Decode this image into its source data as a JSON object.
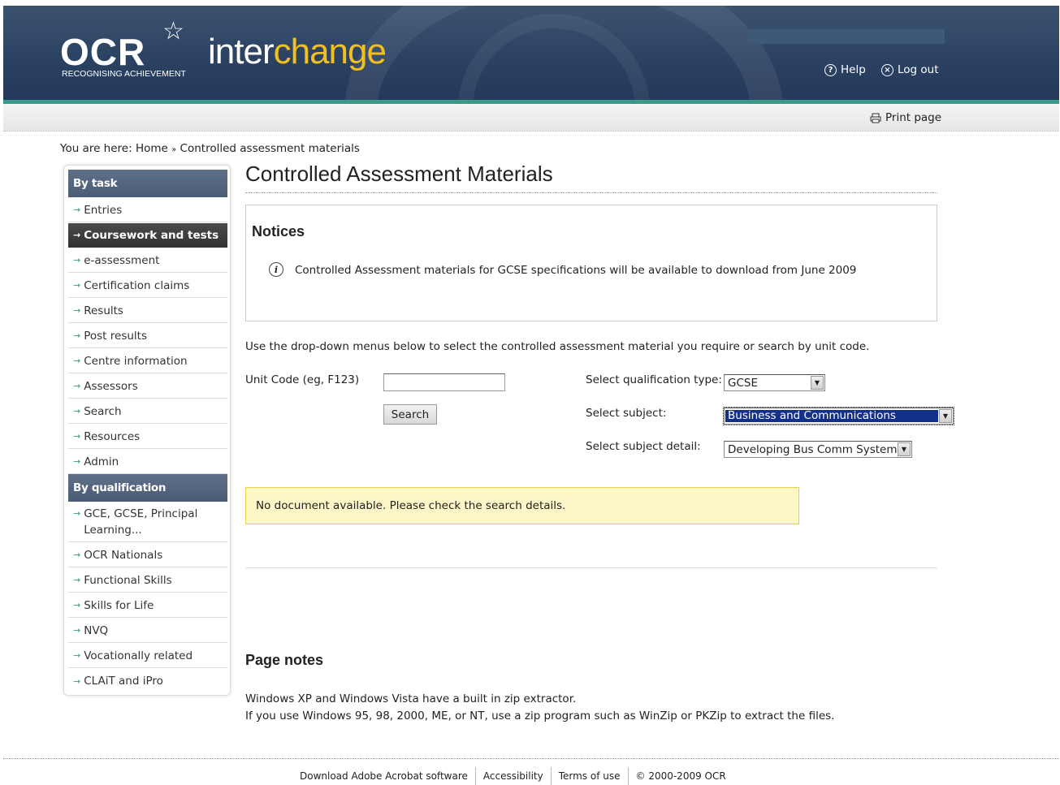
{
  "header": {
    "logo_ocr": "OCR",
    "logo_tagline": "RECOGNISING ACHIEVEMENT",
    "logo_inter": "inter",
    "logo_change": "change",
    "help_label": "Help",
    "logout_label": "Log out",
    "print_label": "Print page"
  },
  "breadcrumb": {
    "prefix": "You are here:",
    "home": "Home",
    "separator": "»",
    "current": "Controlled assessment materials"
  },
  "sidebar": {
    "by_task_title": "By task",
    "task_items": [
      {
        "label": "Entries"
      },
      {
        "label": "Coursework and tests"
      },
      {
        "label": "e-assessment"
      },
      {
        "label": "Certification claims"
      },
      {
        "label": "Results"
      },
      {
        "label": "Post results"
      },
      {
        "label": "Centre information"
      },
      {
        "label": "Assessors"
      },
      {
        "label": "Search"
      },
      {
        "label": "Resources"
      },
      {
        "label": "Admin"
      }
    ],
    "by_qual_title": "By qualification",
    "qual_items": [
      {
        "label": "GCE, GCSE, Principal",
        "label2": "Learning..."
      },
      {
        "label": "OCR Nationals"
      },
      {
        "label": "Functional Skills"
      },
      {
        "label": "Skills for Life"
      },
      {
        "label": "NVQ"
      },
      {
        "label": "Vocationally related"
      },
      {
        "label": "CLAiT and iPro"
      }
    ]
  },
  "main": {
    "title": "Controlled Assessment Materials",
    "notices_title": "Notices",
    "notice_text": "Controlled Assessment materials for GCSE specifications will be available to download from June 2009",
    "intro": "Use the drop-down menus below to select the controlled assessment material you require or search by unit code.",
    "unit_code_label": "Unit Code (eg, F123)",
    "unit_code_value": "",
    "search_button": "Search",
    "qual_type_label": "Select qualification type:",
    "qual_type_value": "GCSE",
    "subject_label": "Select subject:",
    "subject_value": "Business and Communications",
    "subject_detail_label": "Select subject detail:",
    "subject_detail_value": "Developing Bus Comm Systems",
    "no_document": "No document available. Please check the search details.",
    "page_notes_title": "Page notes",
    "notes_line1": "Windows XP and Windows Vista have a built in zip extractor.",
    "notes_line2": "If you use Windows 95, 98, 2000, ME, or NT, use a zip program such as WinZip or PKZip to extract the files."
  },
  "footer": {
    "acrobat": "Download Adobe Acrobat software",
    "accessibility": "Accessibility",
    "terms": "Terms of use",
    "copyright": "© 2000-2009 OCR"
  },
  "colors": {
    "header_bg": "#2c4262",
    "accent_teal": "#3a9a8a",
    "logo_yellow": "#f0c020",
    "sidebar_head": "#4a5b74",
    "notice_yellow": "#fdf7c8"
  }
}
